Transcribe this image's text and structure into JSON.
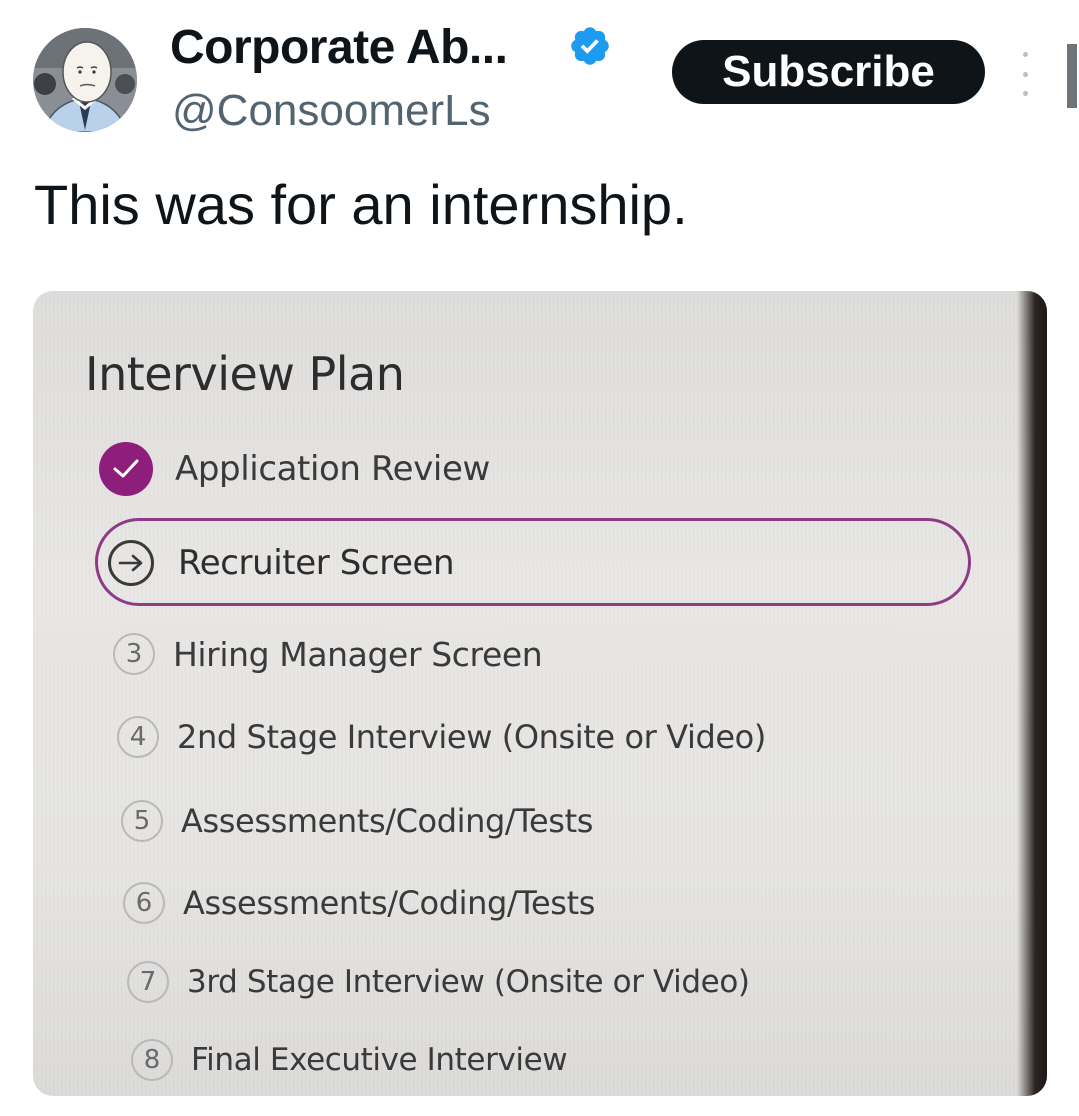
{
  "header": {
    "display_name": "Corporate Ab...",
    "handle": "@ConsoomerLs",
    "subscribe_label": "Subscribe",
    "verified_icon": "verified-badge-icon",
    "more_icon": "more-options-icon"
  },
  "tweet": {
    "text": "This was for an internship."
  },
  "image": {
    "title": "Interview Plan",
    "steps": [
      {
        "number": "",
        "label": "Application Review",
        "status": "completed",
        "icon": "check-icon"
      },
      {
        "number": "",
        "label": "Recruiter Screen",
        "status": "current",
        "icon": "arrow-right-icon"
      },
      {
        "number": "3",
        "label": "Hiring Manager Screen",
        "status": "upcoming"
      },
      {
        "number": "4",
        "label": "2nd Stage Interview (Onsite or Video)",
        "status": "upcoming"
      },
      {
        "number": "5",
        "label": "Assessments/Coding/Tests",
        "status": "upcoming"
      },
      {
        "number": "6",
        "label": "Assessments/Coding/Tests",
        "status": "upcoming"
      },
      {
        "number": "7",
        "label": "3rd Stage Interview (Onsite or Video)",
        "status": "upcoming"
      },
      {
        "number": "8",
        "label": "Final Executive Interview",
        "status": "upcoming"
      }
    ]
  },
  "colors": {
    "accent_purple": "#8e1e7c",
    "subscribe_bg": "#0f1419",
    "verified_blue": "#1d9bf0",
    "handle_gray": "#536471"
  }
}
